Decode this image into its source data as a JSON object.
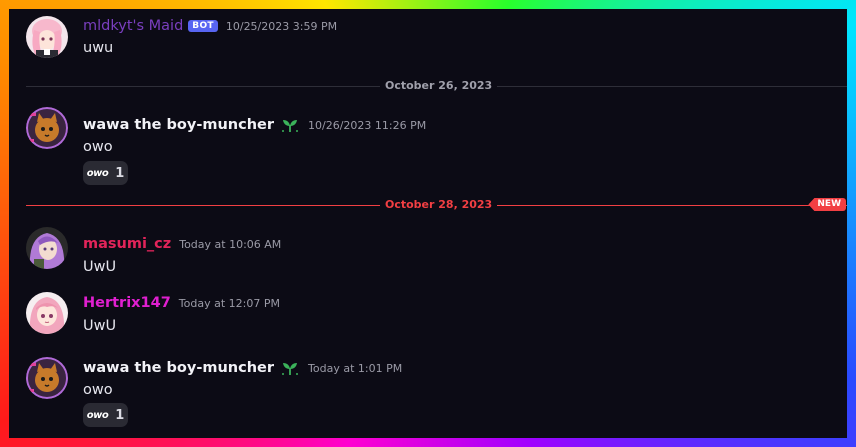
{
  "colors": {
    "maid_name": "#7a3fbf",
    "wawa_name": "#ffffff",
    "masumi_name": "#e2245a",
    "hertrix_name": "#e01fd0",
    "divider_gray": "#3a3a45",
    "divider_new": "#f23f43"
  },
  "messages": [
    {
      "author": "mldkyt's Maid",
      "bot_tag": "BOT",
      "timestamp": "10/25/2023 3:59 PM",
      "text": "uwu"
    },
    {
      "author": "wawa the boy-muncher",
      "timestamp": "10/26/2023 11:26 PM",
      "text": "owo",
      "reaction": {
        "emoji_text": "owo",
        "count": "1"
      }
    },
    {
      "author": "masumi_cz",
      "timestamp": "Today at 10:06 AM",
      "text": "UwU"
    },
    {
      "author": "Hertrix147",
      "timestamp": "Today at 12:07 PM",
      "text": "UwU"
    },
    {
      "author": "wawa the boy-muncher",
      "timestamp": "Today at 1:01 PM",
      "text": "owo",
      "reaction": {
        "emoji_text": "owo",
        "count": "1"
      }
    }
  ],
  "dividers": [
    {
      "date": "October 26, 2023"
    },
    {
      "date": "October 28, 2023",
      "badge": "NEW"
    }
  ],
  "icons": {
    "maid_avatar": "anime-girl-avatar",
    "wawa_avatar": "cat-avatar",
    "masumi_avatar": "anime-purple-hair-avatar",
    "hertrix_avatar": "anime-pink-hair-avatar",
    "wawa_badge": "sprout-icon"
  }
}
